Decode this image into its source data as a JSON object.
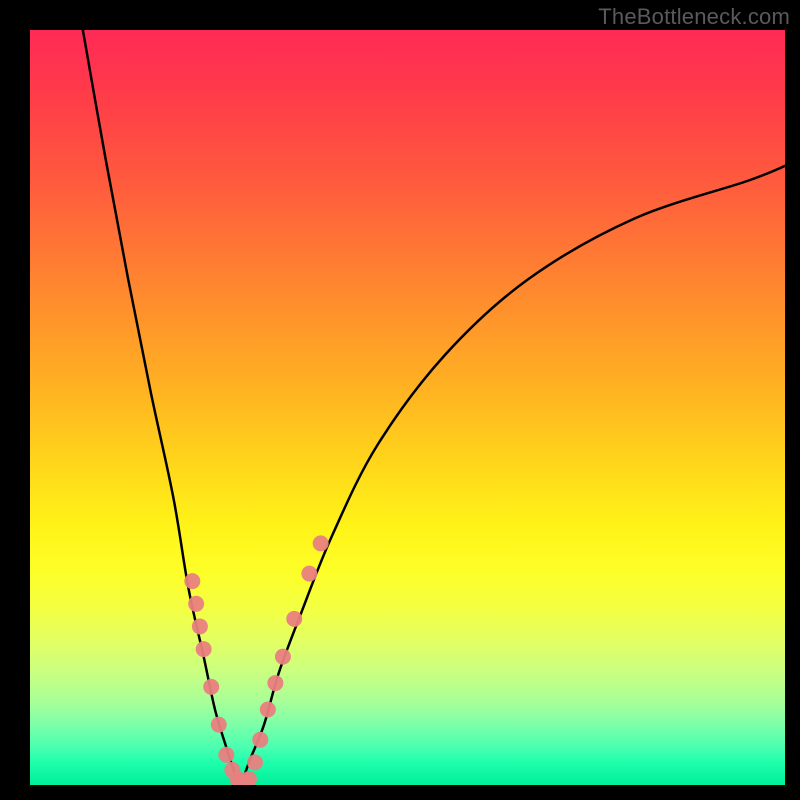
{
  "watermark": "TheBottleneck.com",
  "chart_data": {
    "type": "line",
    "title": "",
    "xlabel": "",
    "ylabel": "",
    "xlim": [
      0,
      100
    ],
    "ylim": [
      0,
      100
    ],
    "grid": false,
    "legend": false,
    "series": [
      {
        "name": "left-curve",
        "x": [
          7,
          10,
          13,
          16,
          19,
          21,
          23,
          24.5,
          26,
          27,
          28
        ],
        "y": [
          100,
          83,
          67,
          52,
          38,
          26,
          17,
          10,
          5,
          2,
          0
        ]
      },
      {
        "name": "right-curve",
        "x": [
          28,
          29,
          31,
          33,
          36,
          40,
          46,
          55,
          66,
          80,
          95,
          100
        ],
        "y": [
          0,
          3,
          8,
          15,
          23,
          33,
          45,
          57,
          67,
          75,
          80,
          82
        ]
      }
    ],
    "scatter_overlay": {
      "name": "hotspots",
      "color": "#e98080",
      "points": [
        {
          "x": 21.5,
          "y": 27
        },
        {
          "x": 22.0,
          "y": 24
        },
        {
          "x": 22.5,
          "y": 21
        },
        {
          "x": 23.0,
          "y": 18
        },
        {
          "x": 24.0,
          "y": 13
        },
        {
          "x": 25.0,
          "y": 8
        },
        {
          "x": 26.0,
          "y": 4
        },
        {
          "x": 26.8,
          "y": 2
        },
        {
          "x": 27.5,
          "y": 0.8
        },
        {
          "x": 28.0,
          "y": 0.3
        },
        {
          "x": 28.5,
          "y": 0.3
        },
        {
          "x": 29.0,
          "y": 0.8
        },
        {
          "x": 29.8,
          "y": 3
        },
        {
          "x": 30.5,
          "y": 6
        },
        {
          "x": 31.5,
          "y": 10
        },
        {
          "x": 32.5,
          "y": 13.5
        },
        {
          "x": 33.5,
          "y": 17
        },
        {
          "x": 35.0,
          "y": 22
        },
        {
          "x": 37.0,
          "y": 28
        },
        {
          "x": 38.5,
          "y": 32
        }
      ]
    },
    "annotations": []
  }
}
